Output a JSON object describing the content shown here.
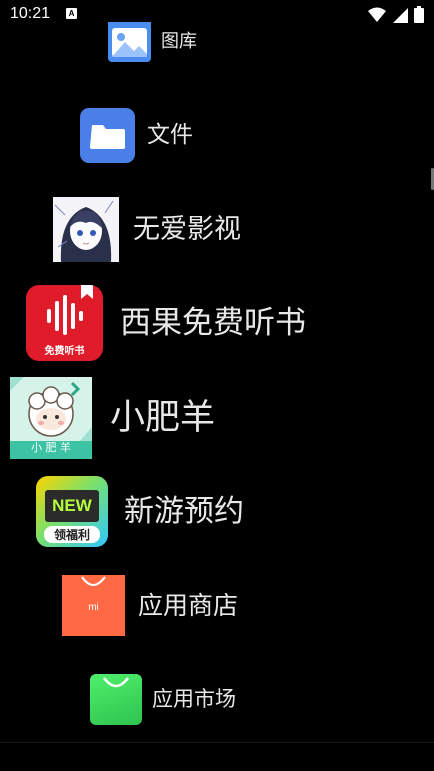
{
  "status_bar": {
    "time": "10:21",
    "notification_badge": "A"
  },
  "apps": [
    {
      "label": "图库",
      "icon": "gallery-icon",
      "color": "#4a8cf0"
    },
    {
      "label": "文件",
      "icon": "folder-icon",
      "color": "#4a7fe8"
    },
    {
      "label": "无爱影视",
      "icon": "anime-girl-icon"
    },
    {
      "label": "西果免费听书",
      "icon": "audiobook-icon",
      "icon_text": "免费听书",
      "color": "#e01b2a"
    },
    {
      "label": "小肥羊",
      "icon": "sheep-icon",
      "icon_text": "小 肥 羊",
      "color": "#3cc3a4"
    },
    {
      "label": "新游预约",
      "icon": "new-game-icon",
      "icon_text_top": "NEW",
      "icon_text_bottom": "领福利"
    },
    {
      "label": "应用商店",
      "icon": "shopping-bag-icon",
      "icon_text": "mi",
      "color": "#ff6a45"
    },
    {
      "label": "应用市场",
      "icon": "market-bag-icon",
      "color": "#3ddc5a"
    }
  ]
}
